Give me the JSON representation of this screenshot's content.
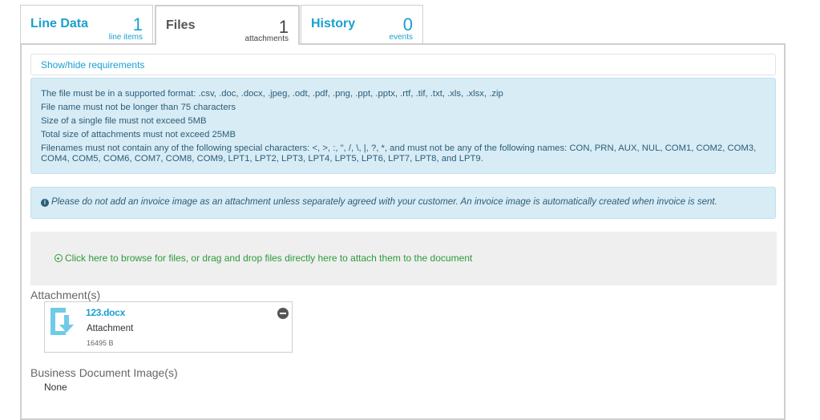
{
  "tabs": [
    {
      "title": "Line Data",
      "count": "1",
      "sub": "line items"
    },
    {
      "title": "Files",
      "count": "1",
      "sub": "attachments"
    },
    {
      "title": "History",
      "count": "0",
      "sub": "events"
    }
  ],
  "requirements": {
    "toggle_label": "Show/hide requirements",
    "lines": [
      "The file must be in a supported format: .csv, .doc, .docx, .jpeg, .odt, .pdf, .png, .ppt, .pptx, .rtf, .tif, .txt, .xls, .xlsx, .zip",
      "File name must not be longer than 75 characters",
      "Size of a single file must not exceed 5MB",
      "Total size of attachments must not exceed 25MB",
      "Filenames must not contain any of the following special characters: <, >, :, \", /, \\, |, ?, *, and must not be any of the following names: CON, PRN, AUX, NUL, COM1, COM2, COM3, COM4, COM5, COM6, COM7, COM8, COM9, LPT1, LPT2, LPT3, LPT4, LPT5, LPT6, LPT7, LPT8, and LPT9."
    ]
  },
  "notice": {
    "icon": "info-icon",
    "text": "Please do not add an invoice image as an attachment unless separately agreed with your customer. An invoice image is automatically created when invoice is sent."
  },
  "dropzone": {
    "icon": "plus-circle-icon",
    "text": "Click here to browse for files, or drag and drop files directly here to attach them to the document"
  },
  "attachments": {
    "title": "Attachment(s)",
    "items": [
      {
        "name": "123.docx",
        "type": "Attachment",
        "size": "16495 B",
        "icon": "document-download-icon"
      }
    ]
  },
  "business_images": {
    "title": "Business Document Image(s)",
    "value": "None"
  },
  "colors": {
    "accent": "#1a9fd0",
    "info_bg": "#d8ecf6",
    "success": "#2e9a3a"
  }
}
